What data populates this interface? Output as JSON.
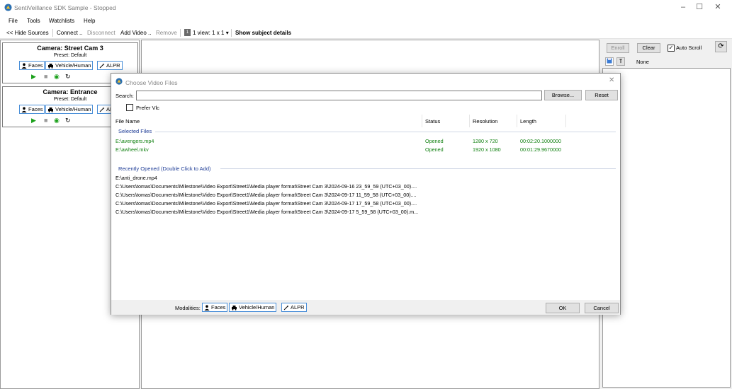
{
  "window": {
    "title": "SentiVeillance SDK Sample - Stopped"
  },
  "menu": [
    "File",
    "Tools",
    "Watchlists",
    "Help"
  ],
  "toolbar": {
    "hide_sources": "<< Hide Sources",
    "connect": "Connect ..",
    "disconnect": "Disconnect",
    "add_video": "Add Video ..",
    "remove": "Remove",
    "view_badge": "1",
    "view": "1 view: 1 x 1",
    "show_details": "Show subject details"
  },
  "cameras": [
    {
      "title": "Camera: Street Cam 3",
      "preset": "Preset: Default"
    },
    {
      "title": "Camera: Entrance",
      "preset": "Preset: Default"
    }
  ],
  "modalities": {
    "faces": "Faces",
    "vehicle": "Vehicle/Human",
    "alpr": "ALPR"
  },
  "right_panel": {
    "enroll": "Enroll",
    "clear": "Clear",
    "auto_scroll": "Auto Scroll",
    "filter_value": "None"
  },
  "dialog": {
    "title": "Choose Video Files",
    "search_label": "Search:",
    "search_value": "",
    "browse": "Browse...",
    "reset": "Reset",
    "prefer_vlc": "Prefer Vlc",
    "columns": {
      "file_name": "File Name",
      "status": "Status",
      "resolution": "Resolution",
      "length": "Length"
    },
    "selected_header": "Selected Files",
    "selected_files": [
      {
        "name": "E:\\avengers.mp4",
        "status": "Opened",
        "resolution": "1280 x 720",
        "length": "00:02:20.1000000"
      },
      {
        "name": "E:\\awheel.mkv",
        "status": "Opened",
        "resolution": "1920 x 1080",
        "length": "00:01:29.9670000"
      }
    ],
    "recent_header": "Recently Opened (Double Click to Add)",
    "recent_files": [
      "E:\\anti_drone.mp4",
      "C:\\Users\\tomas\\Documents\\Milestone\\Video Export\\Street1\\Media player format\\Street Cam 3\\2024-09-16 23_59_59 (UTC+03_00)....",
      "C:\\Users\\tomas\\Documents\\Milestone\\Video Export\\Street1\\Media player format\\Street Cam 3\\2024-09-17 11_59_58 (UTC+03_00)....",
      "C:\\Users\\tomas\\Documents\\Milestone\\Video Export\\Street1\\Media player format\\Street Cam 3\\2024-09-17 17_59_58 (UTC+03_00)....",
      "C:\\Users\\tomas\\Documents\\Milestone\\Video Export\\Street1\\Media player format\\Street Cam 3\\2024-09-17 5_59_58 (UTC+03_00).m..."
    ],
    "modalities_label": "Modalities:",
    "ok": "OK",
    "cancel": "Cancel"
  },
  "colors": {
    "accent_blue": "#1e3c96",
    "opened_green": "#108010",
    "play_green": "#1aa01a",
    "modality_border": "#4a8fd8"
  }
}
